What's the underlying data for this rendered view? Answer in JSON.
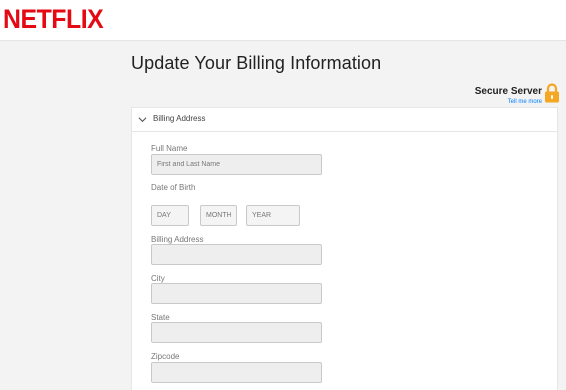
{
  "brand": {
    "logo": "NETFLIX"
  },
  "page": {
    "title": "Update Your Billing Information"
  },
  "secure": {
    "title": "Secure Server",
    "link": "Tell me more"
  },
  "section": {
    "title": "Billing Address"
  },
  "form": {
    "full_name": {
      "label": "Full Name",
      "placeholder": "First and Last Name",
      "value": ""
    },
    "dob": {
      "label": "Date of Birth",
      "day_placeholder": "DAY",
      "month_placeholder": "MONTH",
      "year_placeholder": "YEAR"
    },
    "address": {
      "label": "Billing Address",
      "value": ""
    },
    "city": {
      "label": "City",
      "value": ""
    },
    "state": {
      "label": "State",
      "value": ""
    },
    "zipcode": {
      "label": "Zipcode",
      "value": ""
    }
  },
  "colors": {
    "brand": "#e50914",
    "lock": "#f5a623",
    "link": "#0080ff"
  },
  "icons": {
    "secure": "padlock-icon",
    "collapse": "chevron-down-icon"
  }
}
